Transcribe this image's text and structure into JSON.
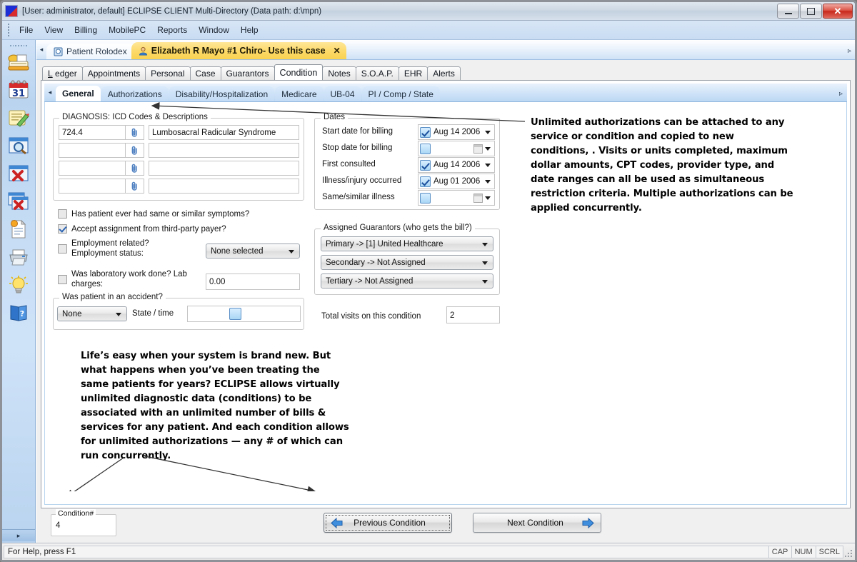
{
  "window": {
    "title": "[User: administrator, default]  ECLIPSE CLIENT Multi-Directory (Data path: d:\\mpn)",
    "app_icon": "eclipse-app-icon",
    "controls": {
      "minimize": "minimize-button",
      "maximize": "maximize-button",
      "close": "✕"
    }
  },
  "menubar": {
    "items": [
      {
        "label": "File"
      },
      {
        "label": "View"
      },
      {
        "label": "Billing"
      },
      {
        "label": "MobilePC"
      },
      {
        "label": "Reports"
      },
      {
        "label": "Window"
      },
      {
        "label": "Help"
      }
    ]
  },
  "sidebar": {
    "items": [
      {
        "name": "rolodex-icon",
        "title": "Rolodex"
      },
      {
        "name": "calendar-icon",
        "title": "Calendar",
        "day": "31"
      },
      {
        "name": "notepad-pencil-icon",
        "title": "Notes"
      },
      {
        "name": "search-window-icon",
        "title": "Find"
      },
      {
        "name": "close-window-icon",
        "title": "Close window"
      },
      {
        "name": "close-all-windows-icon",
        "title": "Close all windows"
      },
      {
        "name": "new-document-icon",
        "title": "New document"
      },
      {
        "name": "printer-icon",
        "title": "Print"
      },
      {
        "name": "lightbulb-icon",
        "title": "Tips"
      },
      {
        "name": "help-book-icon",
        "title": "Help"
      }
    ],
    "collapse_glyph": "▸"
  },
  "patient_tabs": {
    "scroll_left_glyph": "◂",
    "scroll_right_glyph": "▹",
    "tabs": [
      {
        "label": "Patient Rolodex",
        "active": false,
        "closable": false,
        "icon": "rolodex-tab-icon"
      },
      {
        "label": "Elizabeth R Mayo #1 Chiro- Use this case",
        "active": true,
        "closable": true,
        "close_glyph": "✕",
        "icon": "patient-tab-icon"
      }
    ]
  },
  "main_tabs": {
    "items": [
      {
        "label": "Ledger",
        "accel": "L",
        "active": false
      },
      {
        "label": "Appointments",
        "accel": "",
        "active": false
      },
      {
        "label": "Personal",
        "accel": "P",
        "active": false
      },
      {
        "label": "Case",
        "accel": "C",
        "active": false
      },
      {
        "label": "Guarantors",
        "accel": "G",
        "active": false
      },
      {
        "label": "Condition",
        "accel": "n",
        "active": true
      },
      {
        "label": "Notes",
        "accel": "",
        "active": false
      },
      {
        "label": "S.O.A.P.",
        "accel": "",
        "active": false
      },
      {
        "label": "EHR",
        "accel": "",
        "active": false
      },
      {
        "label": "Alerts",
        "accel": "",
        "active": false
      }
    ]
  },
  "sub_tabs": {
    "scroll_left_glyph": "◂",
    "scroll_right_glyph": "▹",
    "items": [
      {
        "label": "General",
        "active": true
      },
      {
        "label": "Authorizations",
        "active": false
      },
      {
        "label": "Disability/Hospitalization",
        "active": false
      },
      {
        "label": "Medicare",
        "active": false
      },
      {
        "label": "UB-04",
        "active": false
      },
      {
        "label": "PI / Comp / State",
        "active": false
      }
    ]
  },
  "diagnosis": {
    "legend": "DIAGNOSIS: ICD Codes & Descriptions",
    "rows": [
      {
        "code": "724.4",
        "description": "Lumbosacral Radicular Syndrome",
        "clip_icon": "paperclip-icon"
      },
      {
        "code": "",
        "description": "",
        "clip_icon": "paperclip-icon"
      },
      {
        "code": "",
        "description": "",
        "clip_icon": "paperclip-icon"
      },
      {
        "code": "",
        "description": "",
        "clip_icon": "paperclip-icon"
      }
    ]
  },
  "checkboxes": {
    "similar_symptoms": {
      "label": "Has patient ever had same or similar symptoms?",
      "checked": false
    },
    "accept_assignment": {
      "label": "Accept assignment from third-party payer?",
      "checked": true
    },
    "employment_related": {
      "label_line1": "Employment related?",
      "label_line2": "Employment status:",
      "checked": false,
      "status_value": "None selected"
    },
    "lab_work": {
      "label_line1": "Was laboratory work done?  Lab",
      "label_line2": "charges:",
      "checked": false,
      "charges_value": "0.00"
    }
  },
  "accident": {
    "legend": "Was patient in an accident?",
    "type_value": "None",
    "state_time_label": "State / time",
    "state_value": "",
    "time_value": ""
  },
  "dates": {
    "legend": "Dates",
    "rows": [
      {
        "label": "Start date for billing",
        "checked": true,
        "value": "Aug 14 2006"
      },
      {
        "label": "Stop date for billing",
        "checked": false,
        "value": ""
      },
      {
        "label": "First consulted",
        "checked": true,
        "value": "Aug 14 2006"
      },
      {
        "label": "Illness/injury occurred",
        "checked": true,
        "value": "Aug 01 2006"
      },
      {
        "label": "Same/similar illness",
        "checked": false,
        "value": ""
      }
    ]
  },
  "guarantors": {
    "legend": "Assigned Guarantors (who gets the bill?)",
    "rows": [
      {
        "value": "Primary -> [1] United Healthcare"
      },
      {
        "value": "Secondary -> Not Assigned"
      },
      {
        "value": "Tertiary -> Not Assigned"
      }
    ],
    "total_visits_label": "Total visits on this condition",
    "total_visits_value": "2"
  },
  "annotations": {
    "top_right": "Unlimited authorizations can be attached to any service or condition and copied to new conditions, . Visits or units completed, maximum dollar amounts, CPT codes, provider type, and date ranges can all be used as simultaneous restriction criteria. Multiple authorizations can be applied concurrently.",
    "bottom_left": "Life’s easy when your system is brand new. But what happens when you’ve been treating the same patients for years? ECLIPSE allows virtually unlimited diagnostic data (conditions) to be associated with an unlimited number of bills & services for any patient. And each condition allows for unlimited authorizations — any # of which can run concurrently."
  },
  "footer": {
    "condition_number_label": "Condition#",
    "condition_number_value": "4",
    "previous_button": "Previous Condition",
    "next_button": "Next Condition",
    "prev_icon": "blue-left-arrow-icon",
    "next_icon": "blue-right-arrow-icon"
  },
  "statusbar": {
    "message": "For Help, press F1",
    "cells": [
      "CAP",
      "NUM",
      "SCRL"
    ]
  },
  "colors": {
    "title_bar": "#cdd8e4",
    "menu_bar": "#cfe0f4",
    "active_patient_tab": "#fcd967",
    "close_button": "#c7281a",
    "accent_blue": "#2e66b5",
    "panel_bg": "#ffffff"
  }
}
